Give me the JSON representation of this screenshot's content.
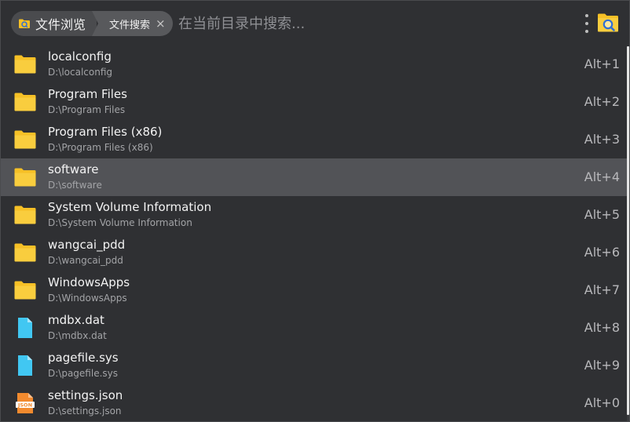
{
  "header": {
    "breadcrumb_primary": "文件浏览",
    "breadcrumb_secondary": "文件搜索",
    "close_glyph": "×",
    "search_placeholder": "在当前目录中搜索..."
  },
  "colors": {
    "folder": "#f6c026",
    "file": "#41c7f2",
    "json": "#f28a2e",
    "selected_row": "#525357"
  },
  "items": [
    {
      "name": "localconfig",
      "path": "D:\\localconfig",
      "hotkey": "Alt+1",
      "icon": "folder-icon"
    },
    {
      "name": "Program Files",
      "path": "D:\\Program Files",
      "hotkey": "Alt+2",
      "icon": "folder-icon"
    },
    {
      "name": "Program Files (x86)",
      "path": "D:\\Program Files (x86)",
      "hotkey": "Alt+3",
      "icon": "folder-icon"
    },
    {
      "name": "software",
      "path": "D:\\software",
      "hotkey": "Alt+4",
      "icon": "folder-icon",
      "selected": true
    },
    {
      "name": "System Volume Information",
      "path": "D:\\System Volume Information",
      "hotkey": "Alt+5",
      "icon": "folder-icon"
    },
    {
      "name": "wangcai_pdd",
      "path": "D:\\wangcai_pdd",
      "hotkey": "Alt+6",
      "icon": "folder-icon"
    },
    {
      "name": "WindowsApps",
      "path": "D:\\WindowsApps",
      "hotkey": "Alt+7",
      "icon": "folder-icon"
    },
    {
      "name": "mdbx.dat",
      "path": "D:\\mdbx.dat",
      "hotkey": "Alt+8",
      "icon": "file-icon"
    },
    {
      "name": "pagefile.sys",
      "path": "D:\\pagefile.sys",
      "hotkey": "Alt+9",
      "icon": "file-icon"
    },
    {
      "name": "settings.json",
      "path": "D:\\settings.json",
      "hotkey": "Alt+0",
      "icon": "json-file-icon",
      "icon_text": "JSON"
    }
  ]
}
